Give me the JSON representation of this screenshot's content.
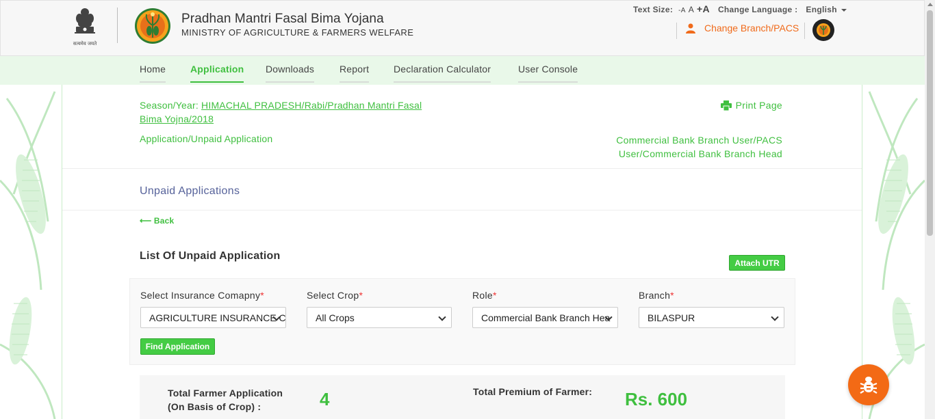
{
  "header": {
    "title": "Pradhan Mantri Fasal Bima Yojana",
    "subtitle": "MINISTRY OF AGRICULTURE & FARMERS WELFARE",
    "emblem_text": "सत्यमेव जयते",
    "text_size_label": "Text Size:",
    "text_small": "-A",
    "text_normal": "A",
    "text_large": "+A",
    "change_language_label": "Change Language :",
    "language": "English",
    "change_branch": "Change Branch/PACS"
  },
  "nav": {
    "items": [
      {
        "label": "Home"
      },
      {
        "label": "Application",
        "active": true
      },
      {
        "label": "Downloads"
      },
      {
        "label": "Report"
      },
      {
        "label": "Declaration Calculator"
      },
      {
        "label": "User Console"
      }
    ]
  },
  "content": {
    "season_label": "Season/Year:",
    "season_value": "HIMACHAL PRADESH/Rabi/Pradhan Mantri Fasal Bima Yojna/2018",
    "print_page": "Print Page",
    "breadcrumb": "Application/Unpaid Application",
    "user_role": "Commercial Bank Branch User/PACS User/Commercial Bank Branch Head",
    "page_heading": "Unpaid Applications",
    "back": "⟵ Back",
    "list_heading": "List Of Unpaid Application",
    "attach_utr": "Attach UTR"
  },
  "filters": {
    "required_mark": "*",
    "insurance_label": "Select Insurance Comapny",
    "insurance_value": "AGRICULTURE INSURANCE CO",
    "crop_label": "Select Crop",
    "crop_value": "All Crops",
    "role_label": "Role",
    "role_value": "Commercial Bank Branch Hea",
    "branch_label": "Branch",
    "branch_value": "BILASPUR",
    "find_button": "Find Application"
  },
  "stats": {
    "farmer_app_label_1": "Total Farmer Application",
    "farmer_app_label_2": "(On Basis of Crop) :",
    "farmer_app_value": "4",
    "premium_label": "Total Premium of Farmer:",
    "premium_value": "Rs. 600"
  },
  "colors": {
    "accent": "#3fbf3f",
    "orange": "#f36a15",
    "nav_bg": "#e9f8e9"
  },
  "icons": [
    "national-emblem-icon",
    "pmfby-logo-icon",
    "user-icon",
    "print-icon",
    "chevron-down-icon",
    "bug-icon"
  ]
}
